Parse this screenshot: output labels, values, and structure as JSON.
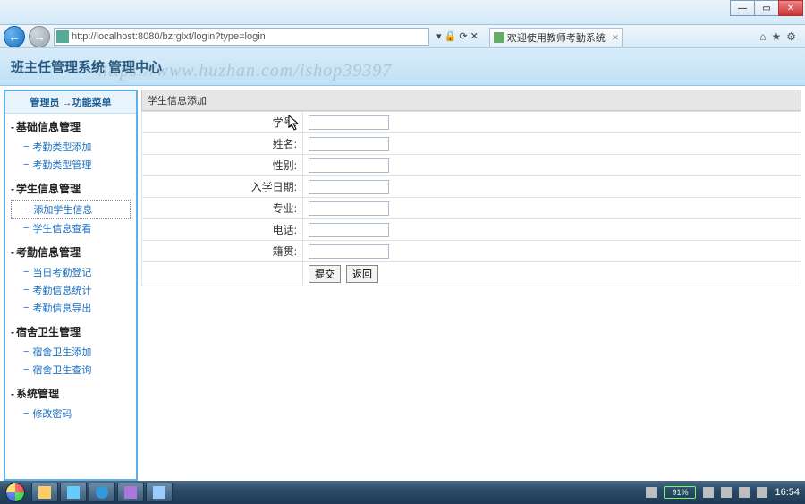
{
  "window": {
    "min": "—",
    "max": "▭",
    "close": "✕"
  },
  "ie": {
    "url": "http://localhost:8080/bzrglxt/login?type=login",
    "search_hint": "ρ",
    "tools": "▾ 🔒 ⟳ ✕",
    "tab_title": "欢迎使用教师考勤系统",
    "icons": {
      "home": "⌂",
      "star": "★",
      "gear": "⚙"
    }
  },
  "header": {
    "title": "班主任管理系统 管理中心",
    "watermark": "https://www.huzhan.com/ishop39397"
  },
  "sidebar": {
    "header": "管理员 →功能菜单",
    "sections": [
      {
        "title": "基础信息管理",
        "items": [
          "考勤类型添加",
          "考勤类型管理"
        ]
      },
      {
        "title": "学生信息管理",
        "items": [
          "添加学生信息",
          "学生信息查看"
        ],
        "active_index": 0
      },
      {
        "title": "考勤信息管理",
        "items": [
          "当日考勤登记",
          "考勤信息统计",
          "考勤信息导出"
        ]
      },
      {
        "title": "宿舍卫生管理",
        "items": [
          "宿舍卫生添加",
          "宿舍卫生查询"
        ]
      },
      {
        "title": "系统管理",
        "items": [
          "修改密码"
        ]
      }
    ]
  },
  "main": {
    "panel_title": "学生信息添加",
    "fields": [
      {
        "label": "学号:"
      },
      {
        "label": "姓名:"
      },
      {
        "label": "性别:"
      },
      {
        "label": "入学日期:"
      },
      {
        "label": "专业:"
      },
      {
        "label": "电话:"
      },
      {
        "label": "籍贯:"
      }
    ],
    "submit": "提交",
    "back": "返回"
  },
  "taskbar": {
    "battery": "91%",
    "clock": "16:54"
  }
}
